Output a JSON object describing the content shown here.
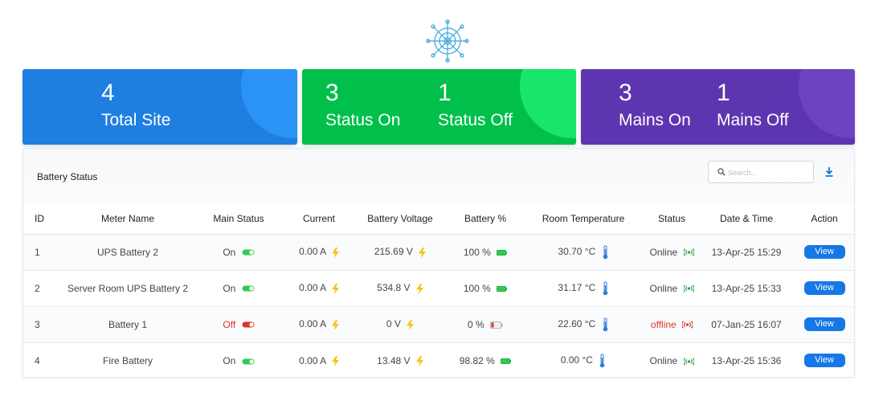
{
  "colors": {
    "blue": "#1e7fe0",
    "green": "#00c04b",
    "purple": "#5e35b1",
    "button": "#1677e6",
    "danger": "#e0342a"
  },
  "summary": {
    "total_site": {
      "value": "4",
      "label": "Total Site"
    },
    "status_on": {
      "value": "3",
      "label": "Status On"
    },
    "status_off": {
      "value": "1",
      "label": "Status Off"
    },
    "mains_on": {
      "value": "3",
      "label": "Mains On"
    },
    "mains_off": {
      "value": "1",
      "label": "Mains Off"
    }
  },
  "panel": {
    "title": "Battery Status",
    "search_placeholder": "Search...",
    "download_icon": "download-icon"
  },
  "table": {
    "headers": [
      "ID",
      "Meter Name",
      "Main Status",
      "Current",
      "Battery Voltage",
      "Battery %",
      "Room Temperature",
      "Status",
      "Date & Time",
      "Action"
    ],
    "rows": [
      {
        "id": "1",
        "name": "UPS Battery 2",
        "main_status": "On",
        "current": "0.00 A",
        "voltage": "215.69 V",
        "battery": "100 %",
        "temp": "30.70 °C",
        "status": "Online",
        "datetime": "13-Apr-25 15:29",
        "action": "View"
      },
      {
        "id": "2",
        "name": "Server Room UPS Battery 2",
        "main_status": "On",
        "current": "0.00 A",
        "voltage": "534.8 V",
        "battery": "100 %",
        "temp": "31.17 °C",
        "status": "Online",
        "datetime": "13-Apr-25 15:33",
        "action": "View"
      },
      {
        "id": "3",
        "name": "Battery 1",
        "main_status": "Off",
        "current": "0.00 A",
        "voltage": "0 V",
        "battery": "0 %",
        "temp": "22.60 °C",
        "status": "offline",
        "datetime": "07-Jan-25 16:07",
        "action": "View"
      },
      {
        "id": "4",
        "name": "Fire Battery",
        "main_status": "On",
        "current": "0.00 A",
        "voltage": "13.48 V",
        "battery": "98.82 %",
        "temp": "0.00 °C",
        "status": "Online",
        "datetime": "13-Apr-25 15:36",
        "action": "View"
      }
    ]
  }
}
